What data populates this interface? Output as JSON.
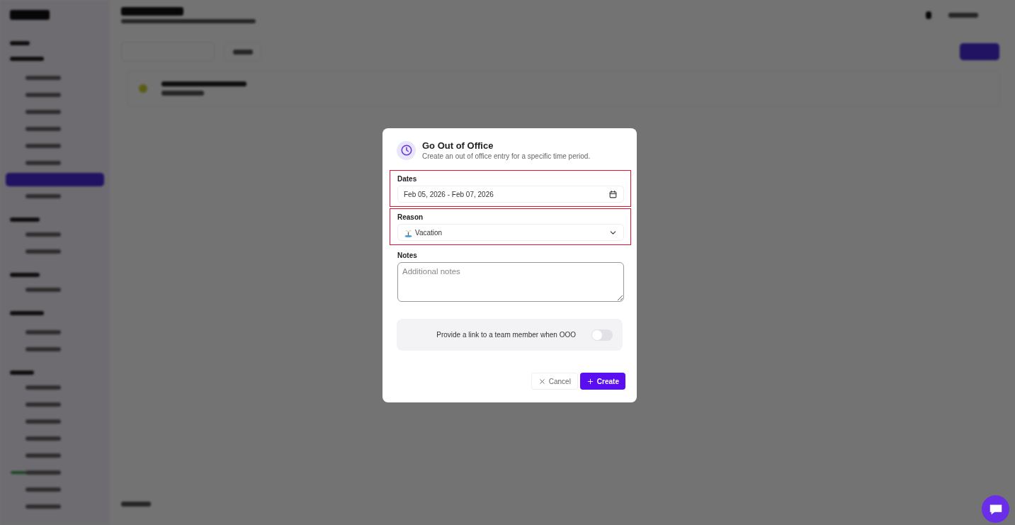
{
  "dialog": {
    "title": "Go Out of Office",
    "subtitle": "Create an out of office entry for a specific time period.",
    "dates": {
      "label": "Dates",
      "value": "Feb 05, 2026 - Feb 07, 2026",
      "highlighted": true
    },
    "reason": {
      "label": "Reason",
      "value": "Vacation",
      "highlighted": true
    },
    "notes": {
      "label": "Notes",
      "placeholder": "Additional notes"
    },
    "link_toggle": {
      "label": "Provide a link to a team member when OOO",
      "on": false
    },
    "buttons": [
      {
        "label": "Cancel",
        "kind": "secondary"
      },
      {
        "label": "Create",
        "kind": "primary"
      }
    ]
  }
}
